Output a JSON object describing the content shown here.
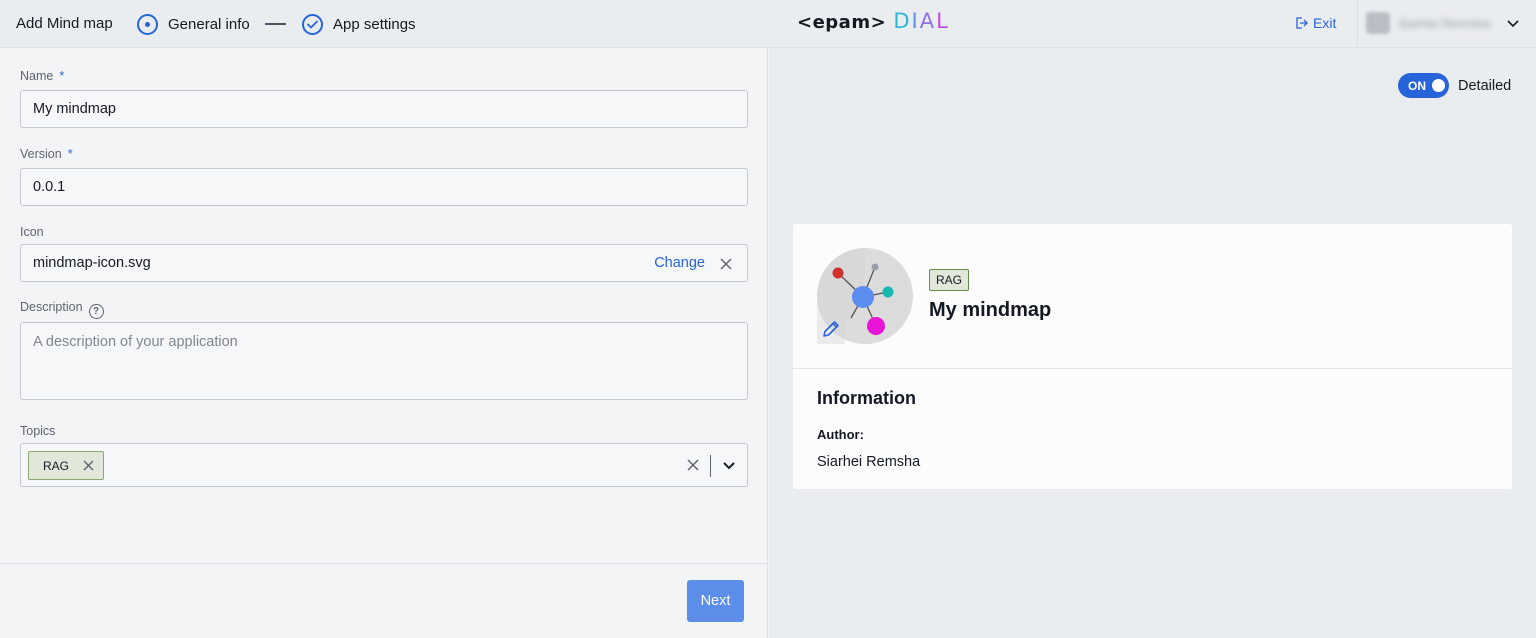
{
  "header": {
    "title": "Add Mind map",
    "steps": [
      {
        "label": "General info",
        "state": "current"
      },
      {
        "label": "App settings",
        "state": "done"
      }
    ],
    "logo": {
      "brand": "<epam>",
      "product": [
        "D",
        "I",
        "A",
        "L"
      ]
    },
    "exit_label": "Exit",
    "user_name": "Siarhei Remsha"
  },
  "form": {
    "name": {
      "label": "Name",
      "required": "*",
      "value": "My mindmap"
    },
    "version": {
      "label": "Version",
      "required": "*",
      "value": "0.0.1"
    },
    "icon": {
      "label": "Icon",
      "value": "mindmap-icon.svg",
      "change_label": "Change"
    },
    "description": {
      "label": "Description",
      "help": "?",
      "placeholder": "A description of your application"
    },
    "topics": {
      "label": "Topics",
      "chips": [
        "RAG"
      ]
    },
    "next_label": "Next"
  },
  "preview": {
    "toggle": {
      "state_label": "ON",
      "label": "Detailed"
    },
    "tag": "RAG",
    "app_name": "My mindmap",
    "info_title": "Information",
    "author_label": "Author:",
    "author_value": "Siarhei Remsha"
  },
  "colors": {
    "accent": "#2764d9",
    "next_button": "#5c8de8",
    "chip_bg": "#e1e8d9",
    "chip_border": "#8ca76f"
  }
}
